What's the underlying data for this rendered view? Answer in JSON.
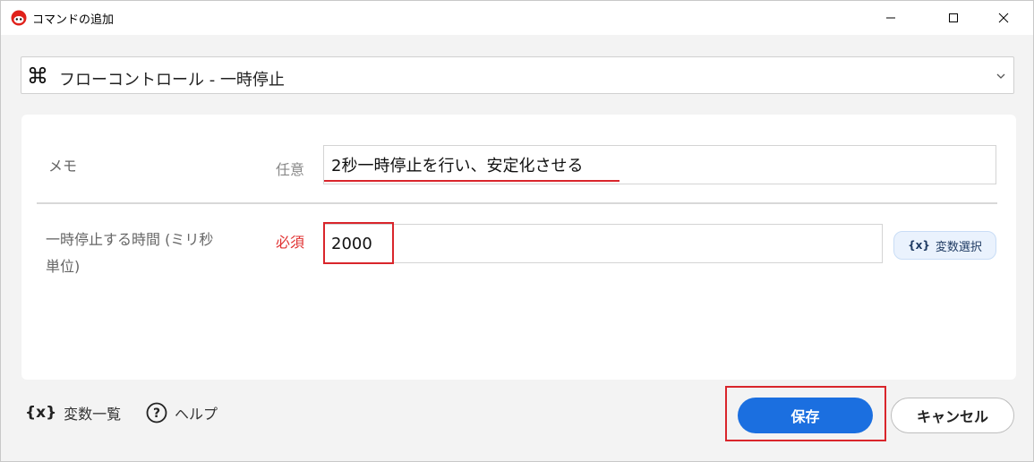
{
  "window": {
    "title": "コマンドの追加"
  },
  "command": {
    "label": "フローコントロール - 一時停止",
    "icon": "command-key-icon"
  },
  "fields": {
    "memo": {
      "label": "メモ",
      "badge": "任意",
      "value": "2秒一時停止を行い、安定化させる"
    },
    "pause_time": {
      "label_line1": "一時停止する時間 (ミリ秒",
      "label_line2": "単位)",
      "badge": "必須",
      "value": "2000",
      "var_select_icon": "{x}",
      "var_select_label": "変数選択"
    }
  },
  "footer": {
    "variables_icon": "{x}",
    "variables_label": "変数一覧",
    "help_icon": "?",
    "help_label": "ヘルプ",
    "save_label": "保存",
    "cancel_label": "キャンセル"
  },
  "colors": {
    "accent": "#1b6fe0",
    "required": "#e03131",
    "highlight": "#d9252b"
  }
}
